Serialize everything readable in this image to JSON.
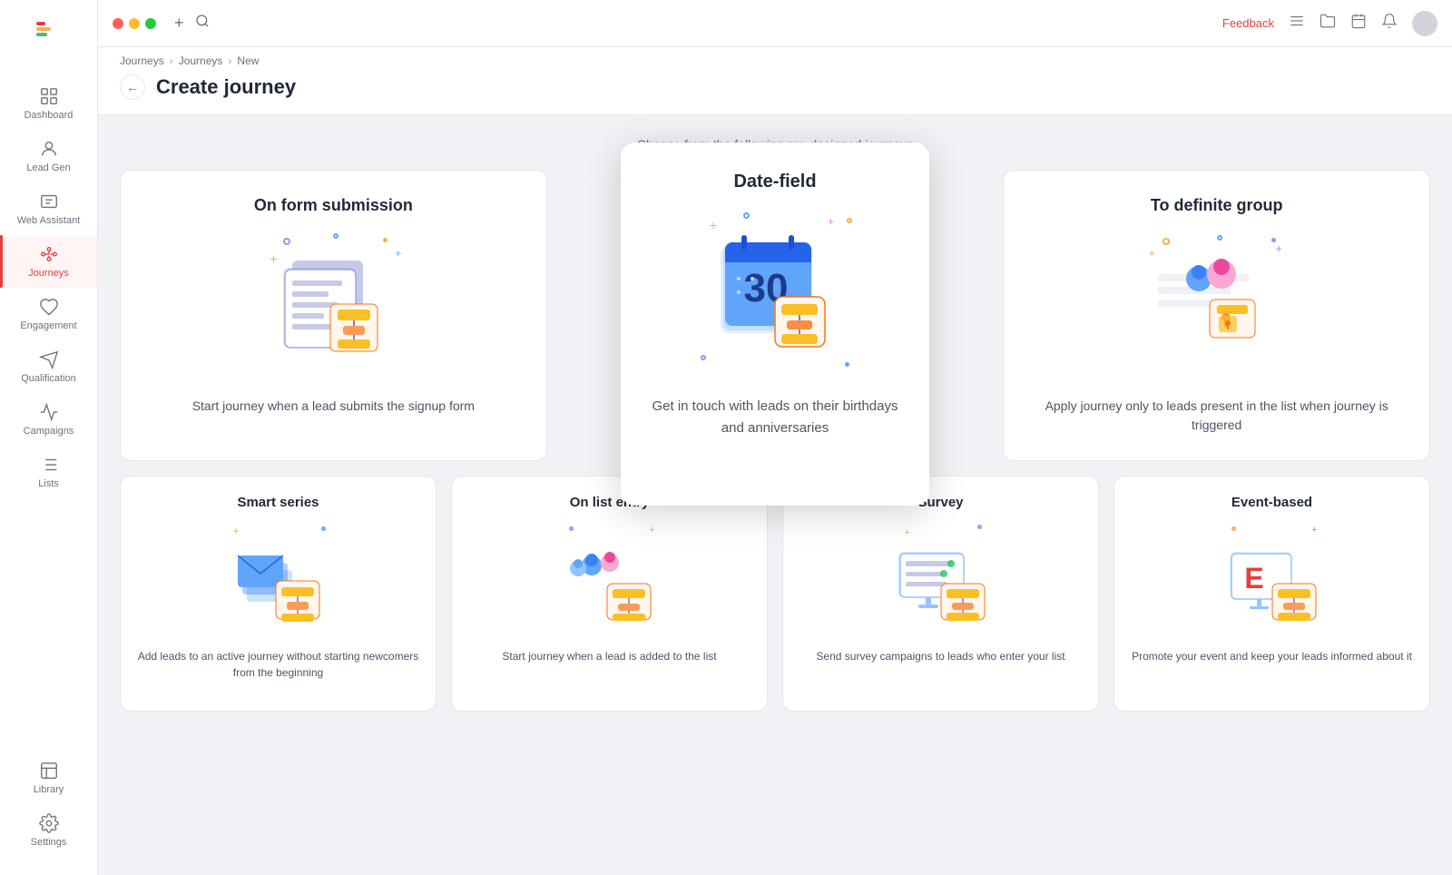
{
  "window": {
    "controls": [
      "close",
      "minimize",
      "maximize"
    ]
  },
  "topbar": {
    "feedback_label": "Feedback",
    "add_label": "+",
    "search_placeholder": "Search"
  },
  "breadcrumb": {
    "items": [
      "Journeys",
      "Journeys",
      "New"
    ],
    "separators": [
      ">",
      ">"
    ]
  },
  "page": {
    "back_label": "←",
    "title": "Create journey",
    "subtitle": "Choose from the following pre-designed journeys"
  },
  "sidebar": {
    "items": [
      {
        "label": "Dashboard",
        "icon": "dashboard-icon"
      },
      {
        "label": "Lead Gen",
        "icon": "leadgen-icon"
      },
      {
        "label": "Web Assistant",
        "icon": "webassistant-icon"
      },
      {
        "label": "Journeys",
        "icon": "journeys-icon",
        "active": true
      },
      {
        "label": "Engagement",
        "icon": "engagement-icon"
      },
      {
        "label": "Qualification",
        "icon": "qualification-icon"
      },
      {
        "label": "Campaigns",
        "icon": "campaigns-icon"
      },
      {
        "label": "Lists",
        "icon": "lists-icon"
      },
      {
        "label": "Library",
        "icon": "library-icon"
      },
      {
        "label": "Settings",
        "icon": "settings-icon"
      }
    ]
  },
  "journey_cards_top": [
    {
      "id": "on-form-submission",
      "title": "On form submission",
      "description": "Start journey when a lead submits the signup form"
    },
    {
      "id": "date-field",
      "title": "Date-field",
      "description": "Get in touch with leads on their birthdays and anniversaries",
      "featured": true
    },
    {
      "id": "to-definite-group",
      "title": "To definite group",
      "description": "Apply journey only to leads present in the list when journey is triggered"
    }
  ],
  "journey_cards_bottom": [
    {
      "id": "smart-series",
      "title": "Smart series",
      "description": "Add leads to an active journey without starting newcomers from the beginning"
    },
    {
      "id": "on-list-entry",
      "title": "On list entry",
      "description": "Start journey when a lead is added to the list"
    },
    {
      "id": "survey",
      "title": "Survey",
      "description": "Send survey campaigns to leads who enter your list"
    },
    {
      "id": "event-based",
      "title": "Event-based",
      "description": "Promote your event and keep your leads informed about it"
    }
  ]
}
